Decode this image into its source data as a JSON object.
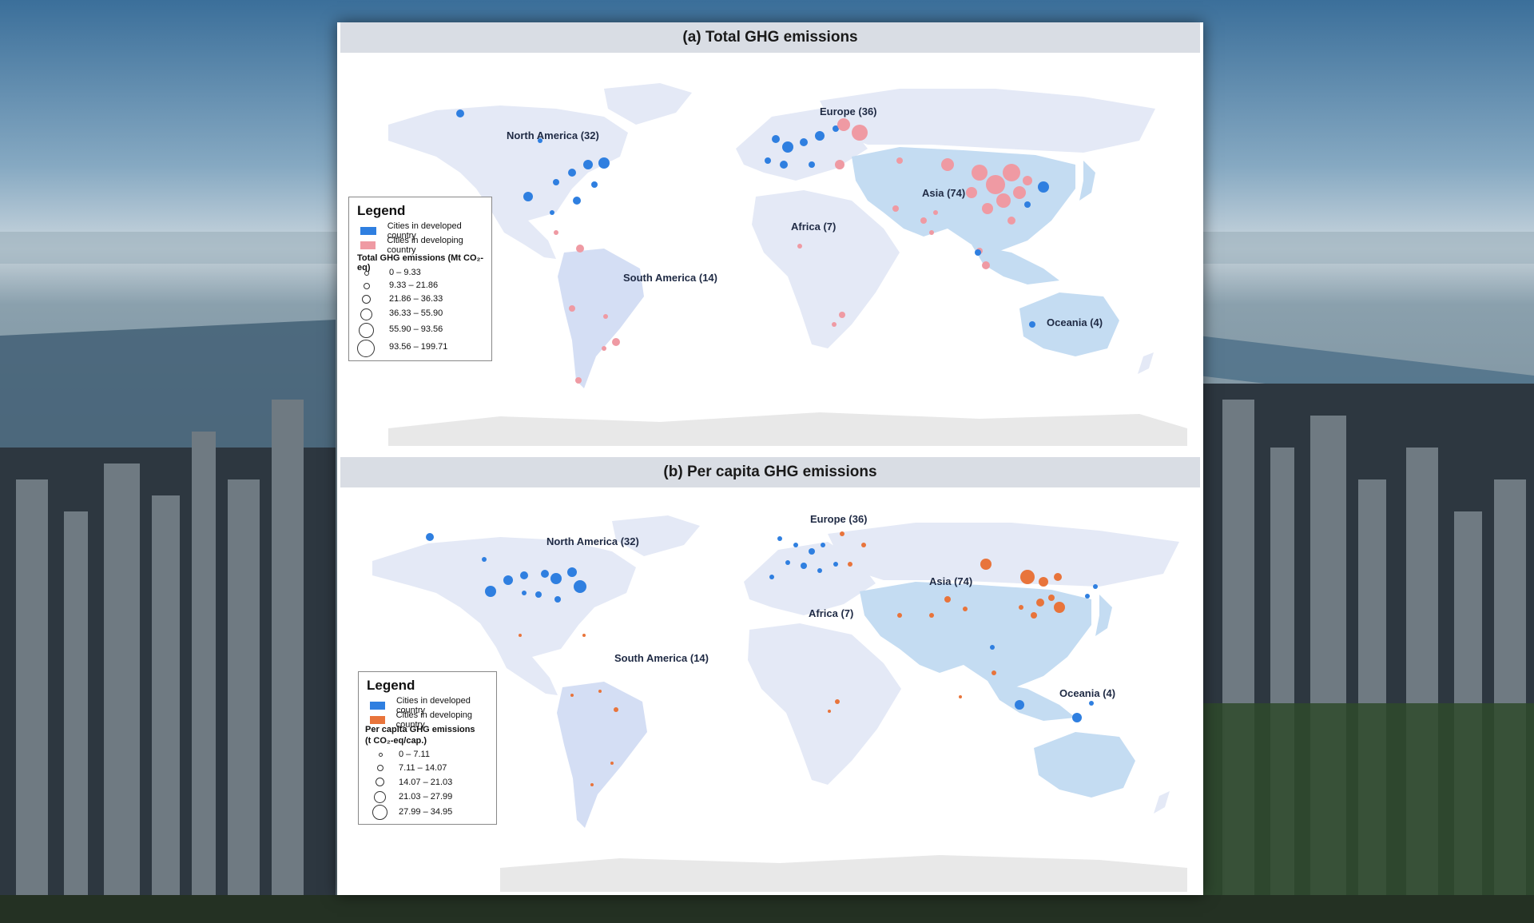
{
  "panels": {
    "a": {
      "title": "(a) Total GHG emissions",
      "regions": {
        "north_america": "North America (32)",
        "europe": "Europe (36)",
        "asia": "Asia (74)",
        "africa": "Africa (7)",
        "south_america": "South America (14)",
        "oceania": "Oceania (4)"
      },
      "legend": {
        "title": "Legend",
        "developed": "Cities in developed country",
        "developing": "Cities in developing country",
        "size_title": "Total GHG emissions (Mt CO₂-eq)",
        "bins": [
          "0 – 9.33",
          "9.33 – 21.86",
          "21.86 – 36.33",
          "36.33 – 55.90",
          "55.90 – 93.56",
          "93.56 – 199.71"
        ]
      }
    },
    "b": {
      "title": "(b) Per capita GHG emissions",
      "regions": {
        "north_america": "North America (32)",
        "europe": "Europe (36)",
        "asia": "Asia (74)",
        "africa": "Africa (7)",
        "south_america": "South America (14)",
        "oceania": "Oceania (4)"
      },
      "legend": {
        "title": "Legend",
        "developed": "Cities in developed country",
        "developing": "Cities in developing country",
        "size_title_1": "Per capita GHG emissions",
        "size_title_2": "(t CO₂-eq/cap.)",
        "bins": [
          "0 – 7.11",
          "7.11 – 14.07",
          "14.07 – 21.03",
          "21.03 – 27.99",
          "27.99 – 34.95"
        ]
      }
    }
  },
  "colors": {
    "developed": "#2f7fe0",
    "developing_a": "#ef9aa3",
    "developing_b": "#e8743b",
    "land": "#e4e9f6",
    "land_highlight": "#c4dcf2",
    "antarctica": "#e8e8e8",
    "title_bar": "#d9dde4"
  }
}
